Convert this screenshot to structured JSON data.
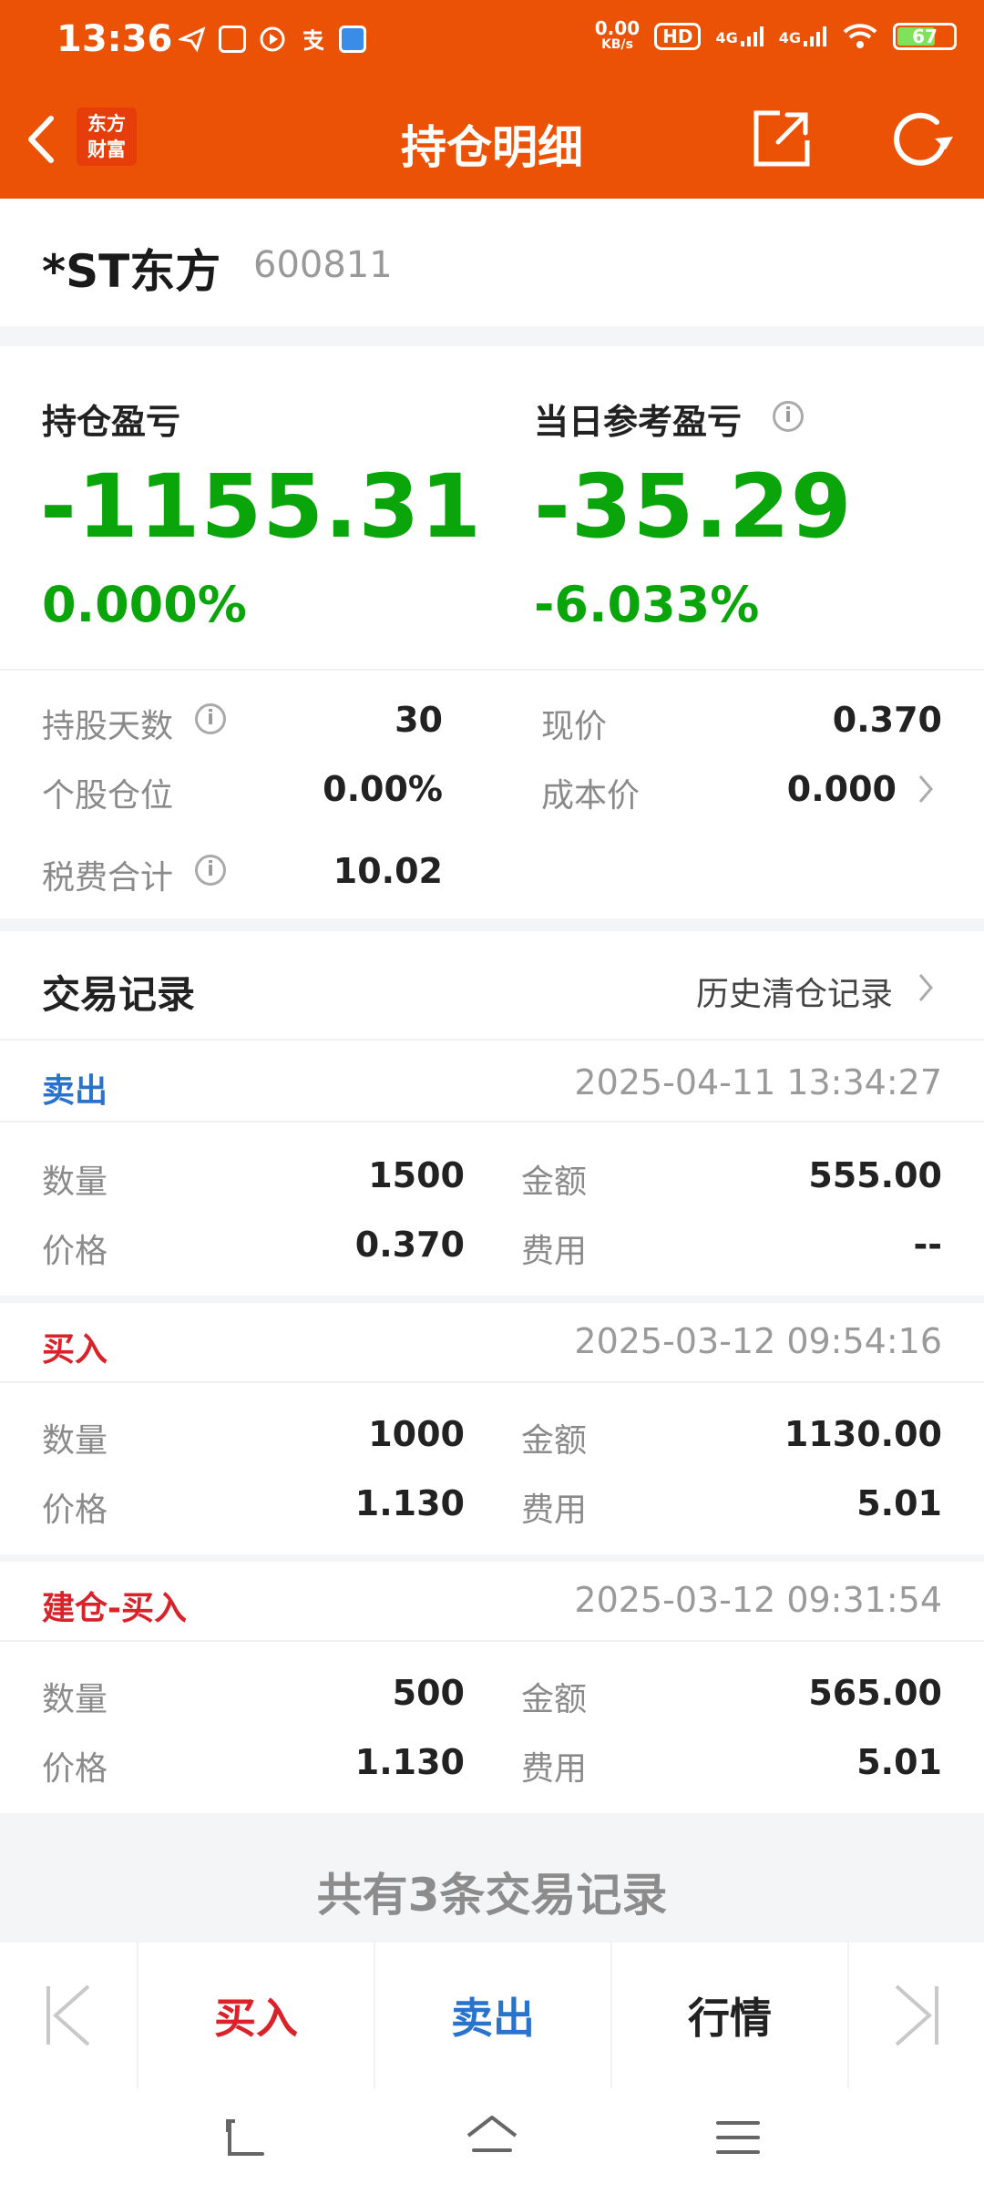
{
  "status": {
    "time": "13:36",
    "net_speed_top": "0.00",
    "net_speed_bottom": "KB/s",
    "hd": "HD",
    "sim1": "4G",
    "sim2": "4G",
    "battery": "67"
  },
  "header": {
    "title": "持仓明细",
    "logo_line1": "东方",
    "logo_line2": "财富"
  },
  "stock": {
    "name": "*ST东方",
    "code": "600811"
  },
  "pnl": {
    "hold_label": "持仓盈亏",
    "hold_value": "-1155.31",
    "hold_pct": "0.000%",
    "daily_label": "当日参考盈亏",
    "daily_value": "-35.29",
    "daily_pct": "-6.033%"
  },
  "info": {
    "days_label": "持股天数",
    "days_value": "30",
    "price_label": "现价",
    "price_value": "0.370",
    "position_label": "个股仓位",
    "position_value": "0.00%",
    "cost_label": "成本价",
    "cost_value": "0.000",
    "fee_label": "税费合计",
    "fee_value": "10.02"
  },
  "trades": {
    "title": "交易记录",
    "history_link": "历史清仓记录",
    "qty_label": "数量",
    "price_label": "价格",
    "amount_label": "金额",
    "fee_label": "费用",
    "records": [
      {
        "type": "卖出",
        "time": "2025-04-11 13:34:27",
        "qty": "1500",
        "price": "0.370",
        "amount": "555.00",
        "fee": "--"
      },
      {
        "type": "买入",
        "time": "2025-03-12 09:54:16",
        "qty": "1000",
        "price": "1.130",
        "amount": "1130.00",
        "fee": "5.01"
      },
      {
        "type": "建仓-买入",
        "time": "2025-03-12 09:31:54",
        "qty": "500",
        "price": "1.130",
        "amount": "565.00",
        "fee": "5.01"
      }
    ],
    "summary": "共有3条交易记录"
  },
  "bottom": {
    "buy": "买入",
    "sell": "卖出",
    "market": "行情"
  },
  "colors": {
    "brand": "#EC5205",
    "gain_green": "#0aa50a",
    "sell_blue": "#2a73cc",
    "buy_red": "#d8232a"
  }
}
